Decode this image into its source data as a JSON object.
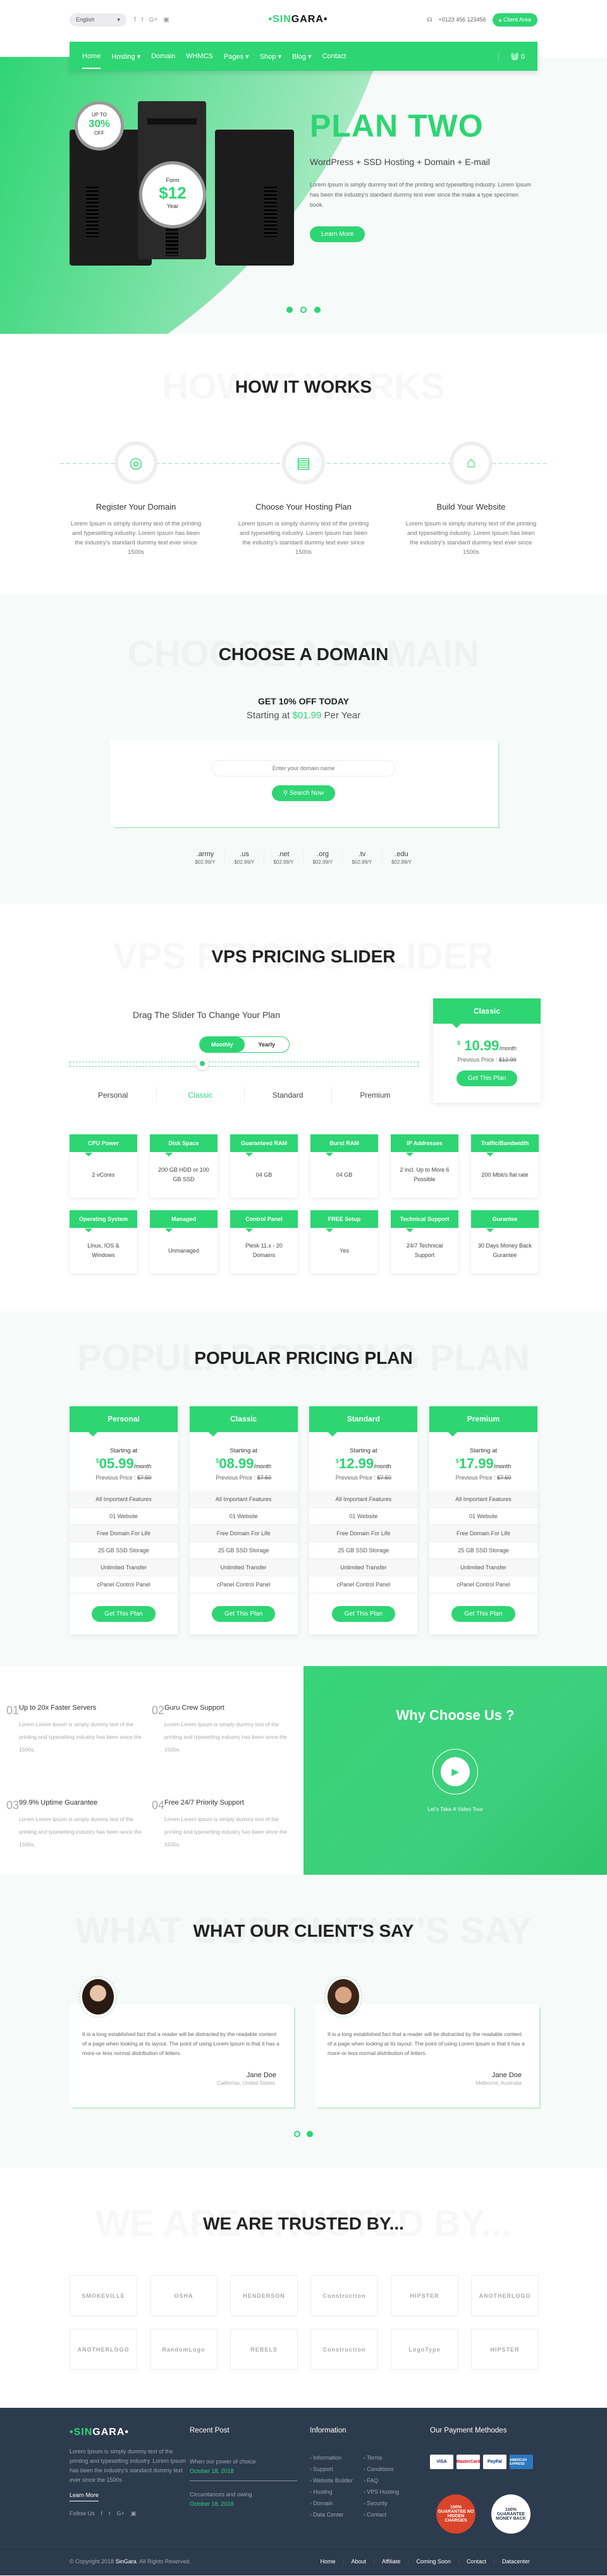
{
  "colors": {
    "accent": "#2ed573",
    "footer_bg": "#2d3b4e",
    "section_bg": "#f6faf8"
  },
  "topbar": {
    "language": "English",
    "social_icons": [
      "facebook-icon",
      "twitter-icon",
      "google-plus-icon",
      "youtube-icon"
    ],
    "logo": {
      "part1": "•SIN",
      "part2": "GARA•"
    },
    "phone": "+0123 456 123456",
    "client_area": "Client Area"
  },
  "nav": {
    "items": [
      {
        "label": "Home",
        "dropdown": false
      },
      {
        "label": "Hosting ▾",
        "dropdown": true
      },
      {
        "label": "Domain",
        "dropdown": false
      },
      {
        "label": "WHMCS",
        "dropdown": false
      },
      {
        "label": "Pages ▾",
        "dropdown": true
      },
      {
        "label": "Shop ▾",
        "dropdown": true
      },
      {
        "label": "Blog ▾",
        "dropdown": true
      },
      {
        "label": "Contact",
        "dropdown": false
      }
    ],
    "cart_count": "0"
  },
  "hero": {
    "badge1": {
      "top": "UP TO",
      "value": "30%",
      "bottom": "OFF"
    },
    "badge2": {
      "top": "Form",
      "value": "$12",
      "bottom": "Year"
    },
    "title": "PLAN TWO",
    "subtitle": "WordPress + SSD Hosting + Domain + E-mail",
    "text": "Lorem Ipsum is simply dummy text of the printing and typesetting industry. Lorem Ipsum has been the industry's standard dummy text ever since the make a type specimen book.",
    "button": "Learn More",
    "active_slide": 2,
    "slides": 3
  },
  "how": {
    "title": "HOW IT WORKS",
    "steps": [
      {
        "icon": "www-globe-icon",
        "title": "Register Your Domain",
        "text": "Lorem Ipsum is simply dummy text of the printing and typesetting industry. Lorem Ipsum has been the industry's standard dummy text ever since 1500s"
      },
      {
        "icon": "server-database-icon",
        "title": "Choose Your Hosting Plan",
        "text": "Lorem Ipsum is simply dummy text of the printing and typesetting industry. Lorem Ipsum has been the industry's standard dummy text ever since 1500s"
      },
      {
        "icon": "rocket-monitor-icon",
        "title": "Build Your Website",
        "text": "Lorem Ipsum is simply dummy text of the printing and typesetting industry. Lorem Ipsum has been the industry's standard dummy text ever since 1500s"
      }
    ]
  },
  "domain": {
    "title": "CHOOSE A DOMAIN",
    "offer": "GET 10% OFF TODAY",
    "start_pre": "Starting at ",
    "start_price": "$01.99",
    "start_post": " Per Year",
    "placeholder": "Enter your domain name",
    "button": "Search Now",
    "tlds": [
      {
        "ext": ".army",
        "price": "$02.99/Y"
      },
      {
        "ext": ".us",
        "price": "$02.99/Y"
      },
      {
        "ext": ".net",
        "price": "$02.99/Y"
      },
      {
        "ext": ".org",
        "price": "$02.99/Y"
      },
      {
        "ext": ".tv",
        "price": "$02.99/Y"
      },
      {
        "ext": ".edu",
        "price": "$02.99/Y"
      }
    ]
  },
  "vps": {
    "title": "VPS PRICING SLIDER",
    "drag": "Drag The Slider To Change Your Plan",
    "toggle": [
      "Monthly",
      "Yearly"
    ],
    "plans": [
      "Personal",
      "Classic",
      "Standard",
      "Premium"
    ],
    "selected_plan": "Classic",
    "card": {
      "name": "Classic",
      "currency": "$",
      "price": "10.99",
      "period": "/month",
      "prev_label": "Previous Price : ",
      "prev_price": "$12.99",
      "button": "Get This Plan"
    },
    "features": [
      {
        "h": "CPU Power",
        "v": "2 vCores"
      },
      {
        "h": "Disk Space",
        "v": "200 GB HDD or 100 GB SSD"
      },
      {
        "h": "Guaranteed RAM",
        "v": "04 GB"
      },
      {
        "h": "Burst RAM",
        "v": "04 GB"
      },
      {
        "h": "IP Addresses",
        "v": "2 incl. Up to More 6 Possible"
      },
      {
        "h": "Traffic/Bandwidth",
        "v": "200 Mbit/s flat rate"
      },
      {
        "h": "Operating System",
        "v": "Linux, IOS & Windows"
      },
      {
        "h": "Managed",
        "v": "Unmanaged"
      },
      {
        "h": "Control Panel",
        "v": "Plesk 11.x - 20 Domains"
      },
      {
        "h": "FREE Setup",
        "v": "Yes"
      },
      {
        "h": "Technical Support",
        "v": "24/7 Technical Support"
      },
      {
        "h": "Gurantee",
        "v": "30 Days Money Back Gurantee"
      }
    ]
  },
  "popular": {
    "title": "POPULAR PRICING PLAN",
    "plans": [
      {
        "name": "Personal",
        "starting": "Starting at",
        "currency": "$",
        "price": "05.99",
        "period": "/month",
        "prev_label": "Previous Price : ",
        "prev": "$7.50",
        "features": [
          "All Important Features",
          "01 Website",
          "Free Domain For Life",
          "25 GB SSD Storage",
          "Unlimited Transfer",
          "cPanel Control Panel"
        ],
        "button": "Get This Plan"
      },
      {
        "name": "Classic",
        "starting": "Starting at",
        "currency": "$",
        "price": "08.99",
        "period": "/month",
        "prev_label": "Previous Price : ",
        "prev": "$7.50",
        "features": [
          "All Important Features",
          "01 Website",
          "Free Domain For Life",
          "25 GB SSD Storage",
          "Unlimited Transfer",
          "cPanel Control Panel"
        ],
        "button": "Get This Plan"
      },
      {
        "name": "Standard",
        "starting": "Starting at",
        "currency": "$",
        "price": "12.99",
        "period": "/month",
        "prev_label": "Previous Price : ",
        "prev": "$7.50",
        "features": [
          "All Important Features",
          "01 Website",
          "Free Domain For Life",
          "25 GB SSD Storage",
          "Unlimited Transfer",
          "cPanel Control Panel"
        ],
        "button": "Get This Plan"
      },
      {
        "name": "Premium",
        "starting": "Starting at",
        "currency": "$",
        "price": "17.99",
        "period": "/month",
        "prev_label": "Previous Price : ",
        "prev": "$7.50",
        "features": [
          "All Important Features",
          "01 Website",
          "Free Domain For Life",
          "25 GB SSD Storage",
          "Unlimited Transfer",
          "cPanel Control Panel"
        ],
        "button": "Get This Plan"
      }
    ]
  },
  "why": {
    "items": [
      {
        "n": "01",
        "title": "Up to 20x Faster Servers",
        "text": "Lorem Lorem Ipsum is simply dummy text of the printing and typesetting industry has been since the 1500s."
      },
      {
        "n": "02",
        "title": "Guru Crew Support",
        "text": "Lorem Lorem Ipsum is simply dummy text of the printing and typesetting industry has been since the 1500s."
      },
      {
        "n": "03",
        "title": "99.9% Uptime Guarantee",
        "text": "Lorem Lorem Ipsum is simply dummy text of the printing and typesetting industry has been since the 1500s."
      },
      {
        "n": "04",
        "title": "Free 24/7 Priority Support",
        "text": "Lorem Lorem Ipsum is simply dummy text of the printing and typesetting industry has been since the 1500s."
      }
    ],
    "title": "Why Choose Us ?",
    "video": "Let's Take A Video Tour"
  },
  "testimonials": {
    "title": "WHAT OUR CLIENT'S SAY",
    "items": [
      {
        "quote": "It is a long established fact that a reader will be distracted by the readable content of a page when looking at its layout. The point of using Lorem Ipsum is that it has a more-or-less normal distribution of letters.",
        "name": "Jane Doe",
        "location": "California, United States."
      },
      {
        "quote": "It is a long established fact that a reader will be distracted by the readable content of a page when looking at its layout. The point of using Lorem Ipsum is that it has a more-or-less normal distribution of letters.",
        "name": "Jane Doe",
        "location": "Melborne, Australia"
      }
    ],
    "active_slide": 1,
    "slides": 2
  },
  "trusted": {
    "title": "WE ARE TRUSTED BY...",
    "logos": [
      "SMOKEVILLE",
      "OSHA",
      "HENDERSON",
      "Construction",
      "HIPSTER",
      "ANOTHERLOGO",
      "ANOTHERLOGO",
      "RandomLogo",
      "REBELS",
      "Construction",
      "LogoType",
      "HIPSTER"
    ]
  },
  "footer": {
    "about": "Lorem Ipsum is simply dummy text of the printing and typesetting industry. Lorem Ipsum has been the industry's standard dummy text ever since the 1500s",
    "learn_more": "Learn More",
    "follow": "Follow Us",
    "recent_title": "Recent Post",
    "posts": [
      {
        "title": "When our power of choice",
        "date": "October 18, 2018"
      },
      {
        "title": "Circumtances and owing",
        "date": "October 18, 2018"
      }
    ],
    "info_title": "Information",
    "links": [
      "Information",
      "Terms",
      "Support",
      "Conditions",
      "Website Builder",
      "FAQ",
      "Hosting",
      "VPS Hosting",
      "Domain",
      "Security",
      "Data Center",
      "Contact"
    ],
    "pay_title": "Our Payment Methodes",
    "payments": [
      "VISA",
      "MasterCard",
      "PayPal",
      "AMERICAN EXPRESS"
    ],
    "seals": [
      "100% GUARANTEE NO HIDDEN CHARGES",
      "100% GUARANTEE MONEY BACK"
    ],
    "copyright_pre": "© Copyright 2018 ",
    "brand": "SinGara",
    "copyright_post": ". All Rights Reserved.",
    "bottom_nav": [
      "Home",
      "About",
      "Affiliate",
      "Coming Soon",
      "Contact",
      "Datacenter"
    ]
  }
}
